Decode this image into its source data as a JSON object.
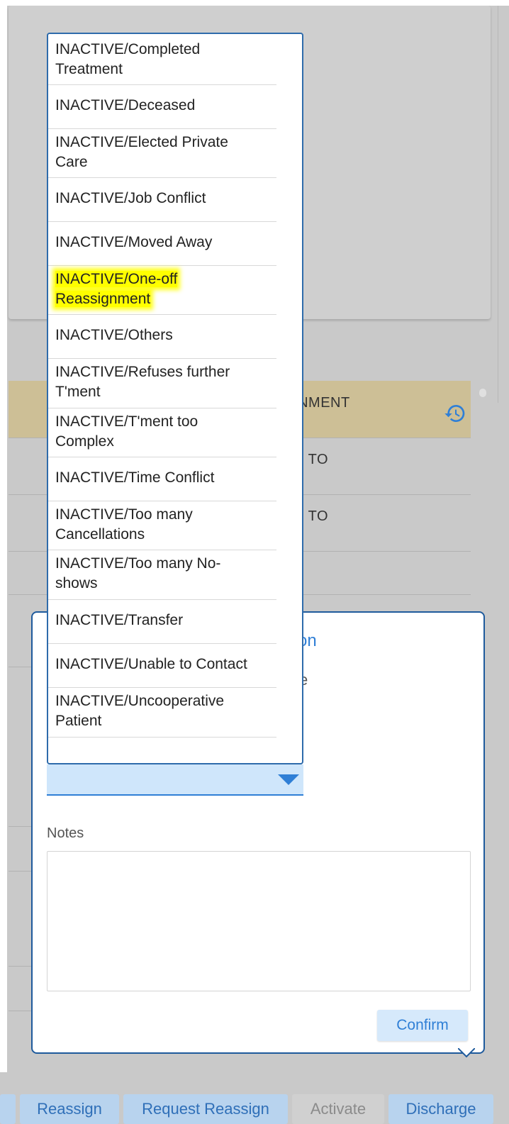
{
  "table": {
    "header_fragment": "IGNMENT",
    "rows": [
      {
        "fragment": "D TO"
      },
      {
        "fragment": "D TO"
      }
    ]
  },
  "popover": {
    "title_fragment": "on",
    "cut_fragment": "e",
    "notes_label": "Notes",
    "notes_value": "",
    "confirm_label": "Confirm"
  },
  "dropdown": {
    "options": [
      {
        "line1": "INACTIVE/Completed",
        "line2": "Treatment"
      },
      {
        "line1": "INACTIVE/Deceased",
        "line2": ""
      },
      {
        "line1": "INACTIVE/Elected Private",
        "line2": "Care"
      },
      {
        "line1": "INACTIVE/Job Conflict",
        "line2": ""
      },
      {
        "line1": "INACTIVE/Moved Away",
        "line2": ""
      },
      {
        "line1": "INACTIVE/One-off",
        "line2": "Reassignment"
      },
      {
        "line1": "INACTIVE/Others",
        "line2": ""
      },
      {
        "line1": "INACTIVE/Refuses further",
        "line2": "T'ment"
      },
      {
        "line1": "INACTIVE/T'ment too",
        "line2": "Complex"
      },
      {
        "line1": "INACTIVE/Time Conflict",
        "line2": ""
      },
      {
        "line1": "INACTIVE/Too many",
        "line2": "Cancellations"
      },
      {
        "line1": "INACTIVE/Too many No-",
        "line2": "shows"
      },
      {
        "line1": "INACTIVE/Transfer",
        "line2": ""
      },
      {
        "line1": "INACTIVE/Unable to Contact",
        "line2": ""
      },
      {
        "line1": "INACTIVE/Uncooperative",
        "line2": "Patient"
      }
    ],
    "highlighted_option": "INACTIVE/One-off Reassignment"
  },
  "actions": {
    "reassign": "Reassign",
    "request_reassign": "Request Reassign",
    "activate": "Activate",
    "discharge": "Discharge"
  },
  "colors": {
    "accent": "#2f7fd6",
    "header_band": "#cdbf96",
    "highlight": "#ffff00"
  }
}
